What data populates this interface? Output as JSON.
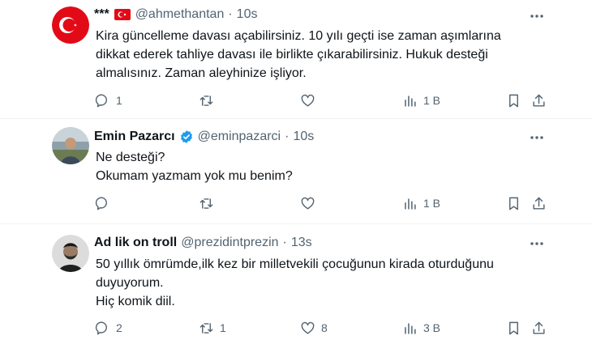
{
  "tweets": [
    {
      "display_name": "***",
      "handle": "@ahmethantan",
      "dot": "·",
      "time": "10s",
      "lines": [
        "Kira güncelleme davası açabilirsiniz. 10 yılı geçti ise zaman aşımlarına",
        "dikkat ederek tahliye davası ile birlikte çıkarabilirsiniz. Hukuk desteği",
        "almalısınız. Zaman aleyhinize işliyor."
      ],
      "replies": "1",
      "retweets": "",
      "likes": "",
      "views": "1 B"
    },
    {
      "display_name": "Emin Pazarcı",
      "handle": "@eminpazarci",
      "dot": "·",
      "time": "10s",
      "lines": [
        "Ne desteği?",
        "Okumam yazmam yok mu benim?"
      ],
      "replies": "",
      "retweets": "",
      "likes": "",
      "views": "1 B"
    },
    {
      "display_name": "Ad lik on troll",
      "handle": "@prezidintprezin",
      "dot": "·",
      "time": "13s",
      "lines": [
        "50 yıllık ömrümde,ilk kez bir milletvekili çocuğunun kirada oturduğunu",
        "duyuyorum.",
        "Hiç komik diil."
      ],
      "replies": "2",
      "retweets": "1",
      "likes": "8",
      "views": "3 B"
    }
  ],
  "icons": {
    "reply": "reply-icon",
    "retweet": "retweet-icon",
    "like": "heart-icon",
    "views": "views-icon",
    "bookmark": "bookmark-icon",
    "share": "share-icon",
    "more": "more-icon",
    "verified": "verified-badge-icon",
    "flag": "turkey-flag-icon"
  },
  "colors": {
    "text": "#0f1419",
    "secondary": "#536471",
    "verified": "#1d9bf0",
    "flag_red": "#e30a17"
  }
}
